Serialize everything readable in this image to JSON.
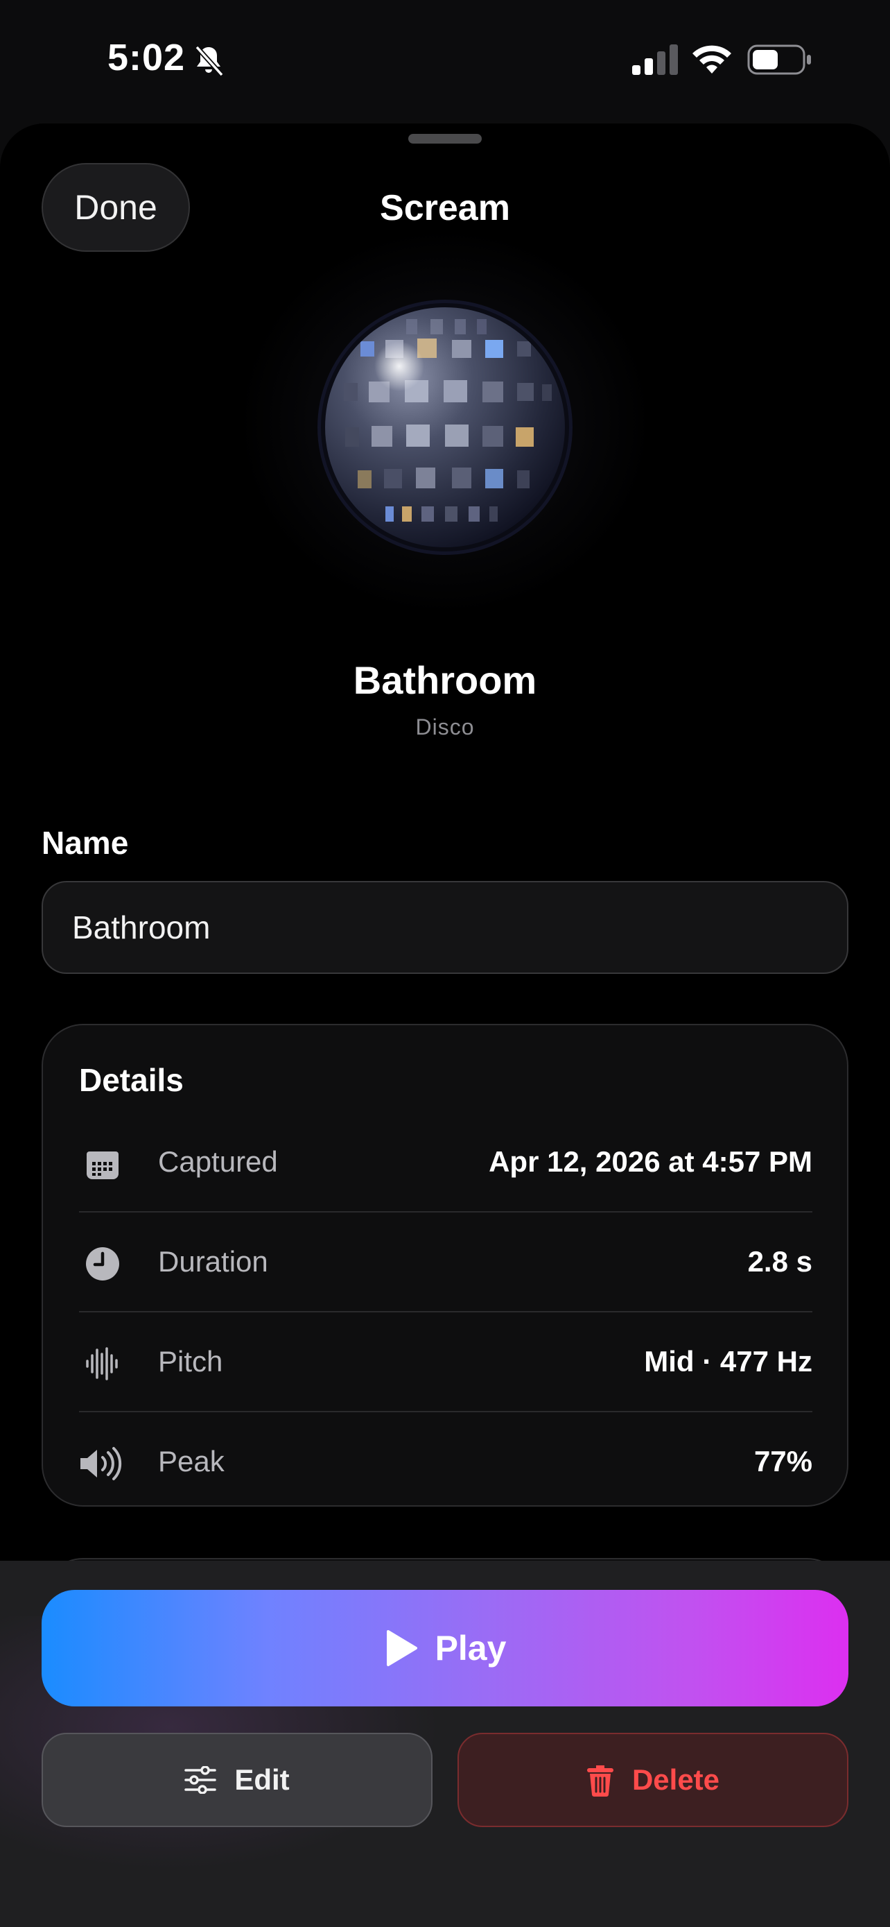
{
  "status_bar": {
    "time": "5:02",
    "icons": [
      "bell-slash-icon",
      "cellular-signal-icon",
      "wifi-icon",
      "battery-icon"
    ]
  },
  "header": {
    "done_label": "Done",
    "title": "Scream"
  },
  "hero": {
    "icon": "disco-ball-icon",
    "place_name": "Bathroom",
    "place_type": "Disco"
  },
  "name_section": {
    "label": "Name",
    "value": "Bathroom"
  },
  "details": {
    "title": "Details",
    "rows": [
      {
        "icon": "calendar-icon",
        "label": "Captured",
        "value": "Apr 12, 2026 at 4:57 PM"
      },
      {
        "icon": "clock-icon",
        "label": "Duration",
        "value": "2.8 s"
      },
      {
        "icon": "waveform-icon",
        "label": "Pitch",
        "value": "Mid · 477 Hz"
      },
      {
        "icon": "speaker-wave-icon",
        "label": "Peak",
        "value": "77%"
      }
    ]
  },
  "actions": {
    "play_label": "Play",
    "edit_label": "Edit",
    "delete_label": "Delete"
  },
  "colors": {
    "play_gradient_start": "#1a8cff",
    "play_gradient_end": "#dc2ff0",
    "delete_red": "#ff4b4b"
  }
}
